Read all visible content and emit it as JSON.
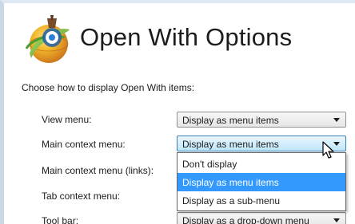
{
  "title": "Open With Options",
  "subtitle": "Choose how to display Open With items:",
  "icon": "internet-explorer-logo",
  "rows": [
    {
      "label": "View menu:",
      "value": "Display as menu items"
    },
    {
      "label": "Main context menu:",
      "value": "Display as menu items"
    },
    {
      "label": "Main context menu (links):",
      "value": ""
    },
    {
      "label": "Tab context menu:",
      "value": ""
    },
    {
      "label": "Tool bar:",
      "value": "Display as a drop-down menu"
    }
  ],
  "dropdown": {
    "options": [
      "Don't display",
      "Display as menu items",
      "Display as a sub-menu"
    ],
    "selected": "Display as menu items"
  },
  "colors": {
    "selection": "#3399ff",
    "combo_active_border": "#3c7fb1",
    "frame_border": "#c9d7e6"
  }
}
